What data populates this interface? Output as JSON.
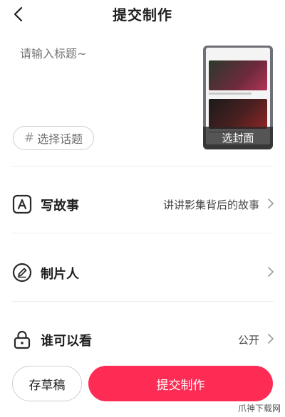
{
  "header": {
    "title": "提交制作",
    "back_icon": "chevron-left-icon"
  },
  "compose": {
    "title_placeholder": "请输入标题~",
    "topic_button": {
      "icon": "hashtag-icon",
      "label": "选择话题"
    },
    "cover": {
      "label": "选封面"
    }
  },
  "settings": [
    {
      "icon": "letter-a-icon",
      "label": "写故事",
      "value": "讲讲影集背后的故事"
    },
    {
      "icon": "pen-icon",
      "label": "制片人",
      "value": ""
    },
    {
      "icon": "lock-icon",
      "label": "谁可以看",
      "value": "公开"
    }
  ],
  "footer": {
    "draft_label": "存草稿",
    "submit_label": "提交制作"
  },
  "watermark": "爪神下载网",
  "colors": {
    "accent": "#fe2c55",
    "text": "#1f1f1f",
    "muted": "#9a9a9a"
  }
}
